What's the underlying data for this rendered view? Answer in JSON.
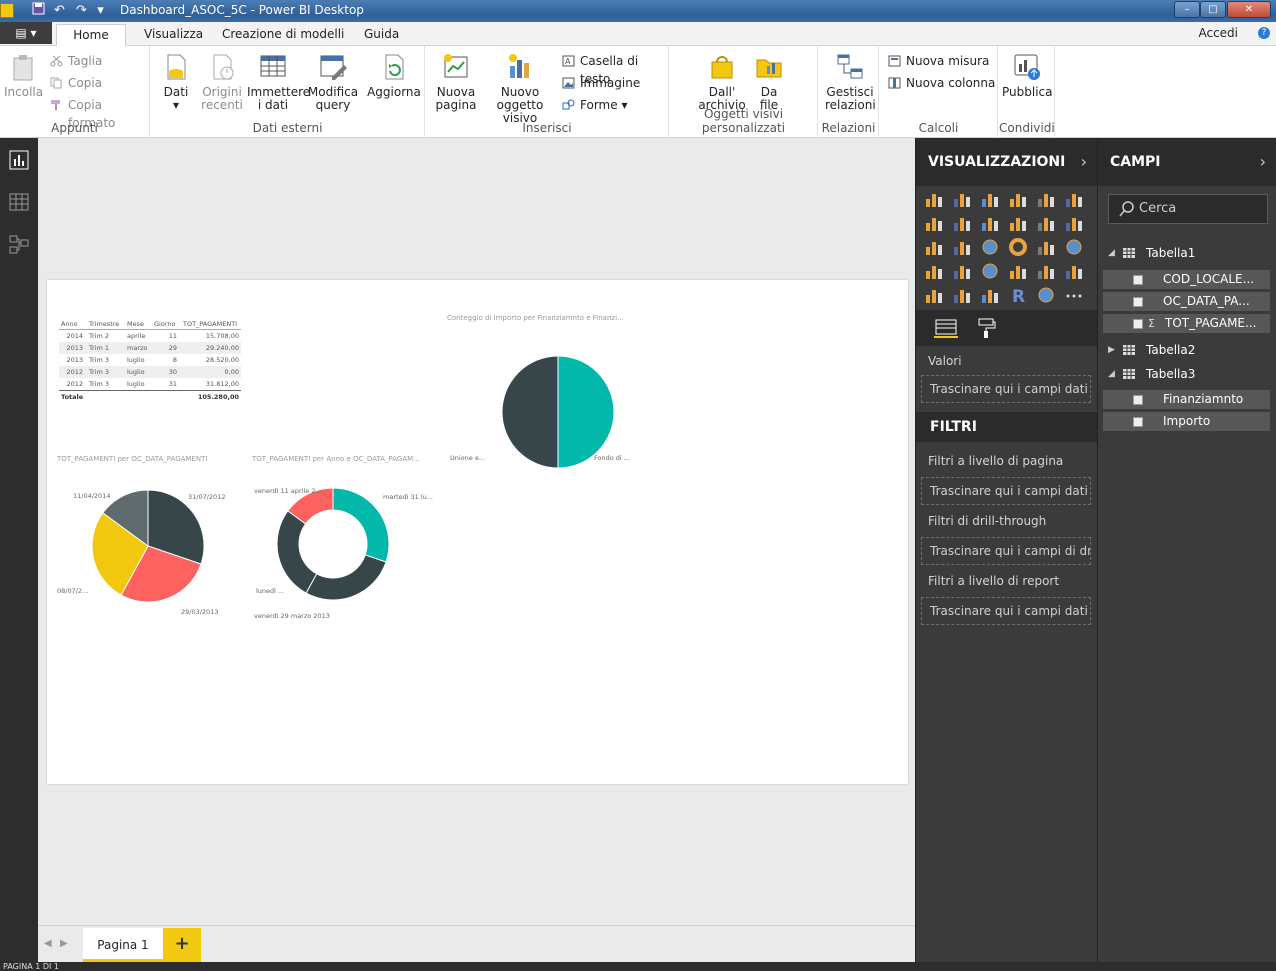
{
  "titlebar": {
    "title": "Dashboard_ASOC_5C - Power BI Desktop",
    "min": "–",
    "max": "□",
    "close": "✕",
    "undo": "↶",
    "redo": "↷",
    "menu": "▾"
  },
  "tabs": {
    "file": "▤ ▾",
    "home": "Home",
    "visualizza": "Visualizza",
    "modelli": "Creazione di modelli",
    "guida": "Guida",
    "accedi": "Accedi",
    "help": "?"
  },
  "ribbon": {
    "appunti": {
      "incolla": "Incolla",
      "taglia": "Taglia",
      "copia": "Copia",
      "copia_formato": "Copia formato",
      "label": "Appunti"
    },
    "dati_esterni": {
      "dati": "Dati",
      "origini": "Origini",
      "recenti": "recenti",
      "immettere": "Immettere",
      "i_dati": "i dati",
      "modifica": "Modifica",
      "query": "query",
      "aggiorna": "Aggiorna",
      "label": "Dati esterni",
      "caret": "▾"
    },
    "inserisci": {
      "nuova": "Nuova",
      "pagina": "pagina",
      "nuovo": "Nuovo",
      "oggetto": "oggetto visivo",
      "casella": "Casella di testo",
      "immagine": "Immagine",
      "forme": "Forme",
      "label": "Inserisci"
    },
    "oggetti": {
      "dall": "Dall'",
      "archivio": "archivio",
      "da": "Da",
      "file": "file",
      "label": "Oggetti visivi personalizzati"
    },
    "relazioni": {
      "gestisci": "Gestisci",
      "relazioni": "relazioni",
      "label": "Relazioni"
    },
    "calcoli": {
      "nuova_misura": "Nuova misura",
      "nuova_colonna": "Nuova colonna",
      "label": "Calcoli"
    },
    "condividi": {
      "pubblica": "Pubblica",
      "label": "Condividi"
    }
  },
  "table_visual": {
    "headers": [
      "Anno",
      "Trimestre",
      "Mese",
      "Giorno",
      "TOT_PAGAMENTI"
    ],
    "rows": [
      [
        "2014",
        "Trim 2",
        "aprile",
        "11",
        "15.708,00"
      ],
      [
        "2013",
        "Trim 1",
        "marzo",
        "29",
        "29.240,00"
      ],
      [
        "2013",
        "Trim 3",
        "luglio",
        "8",
        "28.520,00"
      ],
      [
        "2012",
        "Trim 3",
        "luglio",
        "30",
        "0,00"
      ],
      [
        "2012",
        "Trim 3",
        "luglio",
        "31",
        "31.812,00"
      ]
    ],
    "total_label": "Totale",
    "total_value": "105.280,00"
  },
  "chart_data": [
    {
      "type": "pie",
      "title": "Conteggio di Importo per Finanziamnto e Finanzi...",
      "categories": [
        "Fondo di ...",
        "Unione e..."
      ],
      "values": [
        50,
        50
      ],
      "colors": [
        "#01b8aa",
        "#374649"
      ]
    },
    {
      "type": "pie",
      "title": "TOT_PAGAMENTI per OC_DATA_PAGAMENTI",
      "categories": [
        "31/07/2012",
        "29/03/2013",
        "08/07/2...",
        "11/04/2014"
      ],
      "values": [
        31812,
        29240,
        28520,
        15708
      ],
      "colors": [
        "#374649",
        "#fd625e",
        "#f2c80f",
        "#5f6b6d"
      ]
    },
    {
      "type": "pie",
      "title": "TOT_PAGAMENTI per Anno e OC_DATA_PAGAM...",
      "categories": [
        "martedì 31 lu...",
        "venerdì 29 marzo 2013",
        "lunedì ...",
        "venerdì 11 aprile 2..."
      ],
      "values": [
        31812,
        29240,
        28520,
        15708
      ],
      "colors": [
        "#01b8aa",
        "#374649",
        "#374649",
        "#fd625e"
      ],
      "donut": true
    }
  ],
  "pages": {
    "page1": "Pagina 1",
    "add": "+",
    "prev": "◀",
    "next": "▶"
  },
  "status": "PAGINA 1 DI 1",
  "viz_pane": {
    "title": "VISUALIZZAZIONI",
    "chevron": "›",
    "valori": "Valori",
    "drop_values": "Trascinare qui i campi dati",
    "filtri": "FILTRI",
    "filtri_pagina": "Filtri a livello di pagina",
    "drop_page": "Trascinare qui i campi dati",
    "filtri_drill": "Filtri di drill-through",
    "drop_drill": "Trascinare qui i campi di dr...",
    "filtri_report": "Filtri a livello di report",
    "drop_report": "Trascinare qui i campi dati",
    "more": "···",
    "r_icon": "R"
  },
  "fields_pane": {
    "title": "CAMPI",
    "chevron": "›",
    "search_placeholder": "Cerca",
    "tables": [
      {
        "name": "Tabella1",
        "arrow": "◢"
      },
      {
        "name": "Tabella2",
        "arrow": "▶"
      },
      {
        "name": "Tabella3",
        "arrow": "◢"
      }
    ],
    "tabella1_fields": [
      "COD_LOCALE...",
      "OC_DATA_PA...",
      "TOT_PAGAME..."
    ],
    "sigma": "Σ",
    "tabella3_fields": [
      "Finanziamnto",
      "Importo"
    ]
  }
}
